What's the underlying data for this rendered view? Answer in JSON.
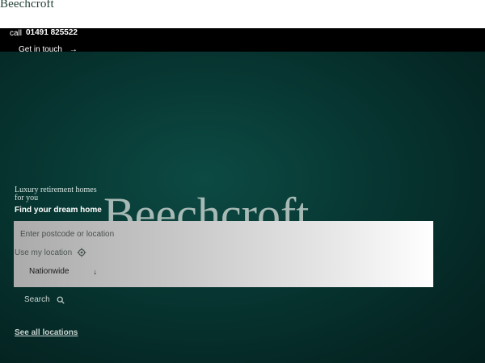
{
  "header": {
    "logo": "Beechcroft"
  },
  "call_bar": {
    "label": "call",
    "phone": "01491 825522"
  },
  "contact": {
    "label": "Get in touch",
    "arrow_icon": "arrow-right-icon"
  },
  "hero": {
    "tagline": "Luxury retirement homes for you",
    "title": "Find your dream home",
    "background_word": "Beechcroft"
  },
  "search_form": {
    "postcode_placeholder": "Enter postcode or location",
    "use_location_label": "Use my location",
    "location_icon": "crosshair-icon",
    "area_select": "Nationwide",
    "search_label": "Search",
    "search_icon": "search-icon"
  },
  "links": {
    "all_locations": "See all locations"
  },
  "colors": {
    "hero_bg": "#083a35",
    "call_bar_bg": "#000000",
    "logo": "#1f3d36"
  }
}
